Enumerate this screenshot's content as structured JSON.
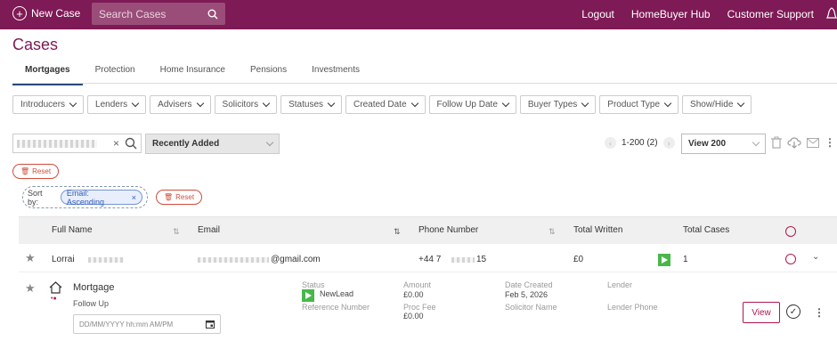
{
  "topbar": {
    "new_case": "New Case",
    "search_placeholder": "Search Cases",
    "links": [
      "Logout",
      "HomeBuyer Hub",
      "Customer Support"
    ]
  },
  "page_title": "Cases",
  "tabs": [
    "Mortgages",
    "Protection",
    "Home Insurance",
    "Pensions",
    "Investments"
  ],
  "filters": [
    "Introducers",
    "Lenders",
    "Advisers",
    "Solicitors",
    "Statuses",
    "Created Date",
    "Follow Up Date",
    "Buyer Types",
    "Product Type",
    "Show/Hide"
  ],
  "toolbar": {
    "sort_selected": "Recently Added",
    "pager_text": "1-200 (2)",
    "view_selected": "View 200",
    "reset_label": "Reset"
  },
  "sort": {
    "label": "Sort by:",
    "chip": "Email: Ascending",
    "reset_label": "Reset"
  },
  "table": {
    "headers": [
      "Full Name",
      "Email",
      "Phone Number",
      "Total Written",
      "Total Cases"
    ],
    "row": {
      "name": "Lorrai",
      "email": "@gmail.com",
      "phone_prefix": "+44 7",
      "phone_suffix": "15",
      "total_written": "£0",
      "total_cases": "1"
    }
  },
  "detail": {
    "title": "Mortgage",
    "follow_up": "Follow Up",
    "datetime_placeholder": "DD/MM/YYYY hh:mm AM/PM",
    "status_label": "Status",
    "status_value": "NewLead",
    "ref_label": "Reference Number",
    "amount_label": "Amount",
    "amount_value": "£0.00",
    "proc_label": "Proc Fee",
    "proc_value": "£0.00",
    "date_label": "Date Created",
    "date_value": "Feb 5, 2026",
    "solicitor_label": "Solicitor Name",
    "lender_label": "Lender",
    "lender_phone_label": "Lender Phone",
    "view_label": "View"
  }
}
